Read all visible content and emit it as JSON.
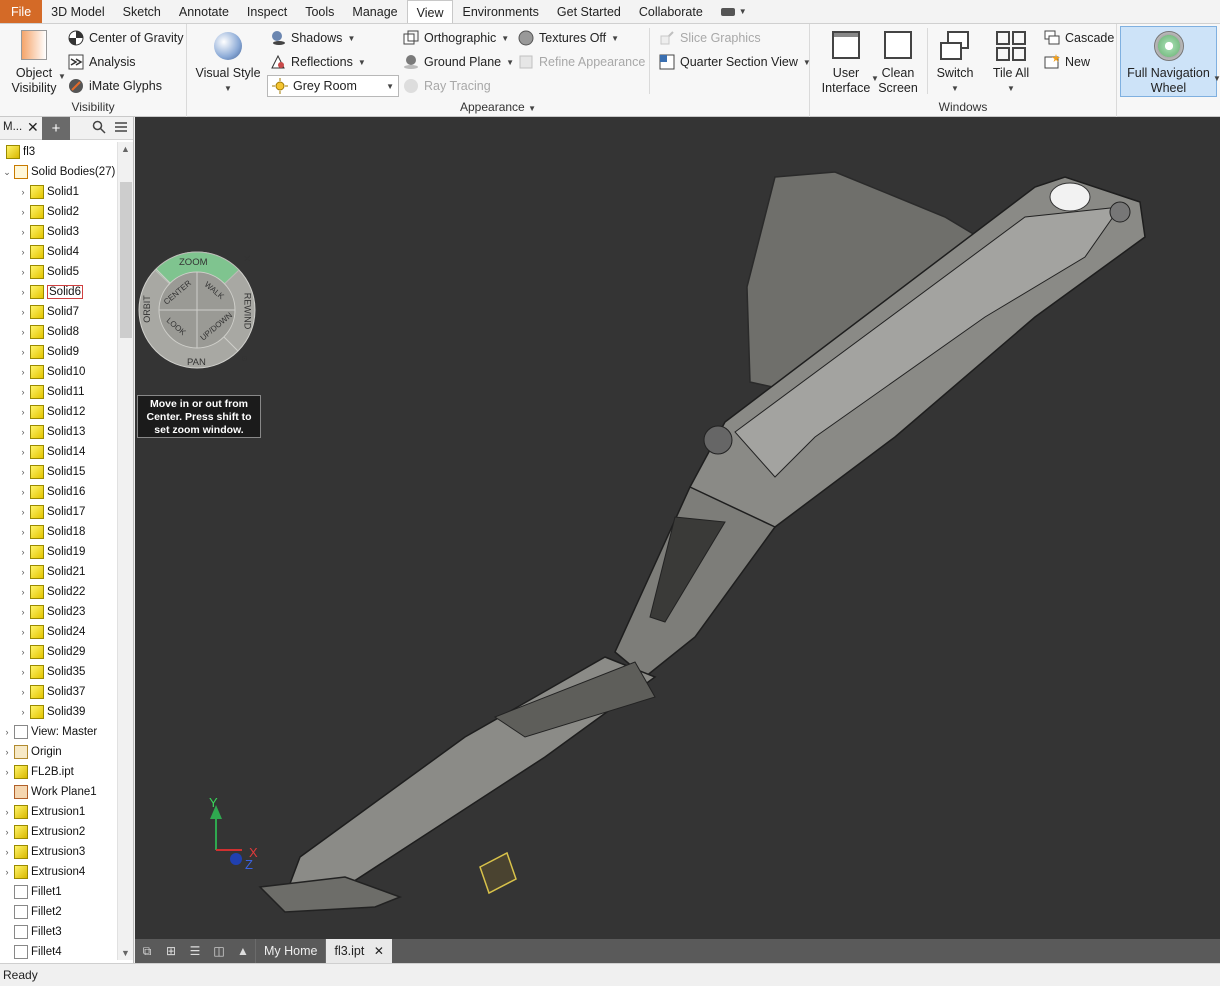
{
  "menu": {
    "tabs": [
      "File",
      "3D Model",
      "Sketch",
      "Annotate",
      "Inspect",
      "Tools",
      "Manage",
      "View",
      "Environments",
      "Get Started",
      "Collaborate"
    ],
    "active_tab": "View"
  },
  "ribbon": {
    "visibility": {
      "title": "Visibility",
      "object_visibility": "Object\nVisibility",
      "center_of_gravity": "Center of Gravity",
      "analysis": "Analysis",
      "imate_glyphs": "iMate Glyphs"
    },
    "appearance": {
      "title": "Appearance",
      "visual_style": "Visual Style",
      "shadows": "Shadows",
      "reflections": "Reflections",
      "lighting_value": "Grey Room",
      "orthographic": "Orthographic",
      "ground_plane": "Ground Plane",
      "ray_tracing": "Ray Tracing",
      "textures_off": "Textures Off",
      "refine_appearance": "Refine Appearance",
      "slice_graphics": "Slice Graphics",
      "quarter_section_view": "Quarter Section View"
    },
    "windows": {
      "title": "Windows",
      "user_interface": "User\nInterface",
      "clean_screen": "Clean\nScreen",
      "switch": "Switch",
      "tile_all": "Tile All",
      "cascade": "Cascade",
      "new": "New"
    },
    "navigate": {
      "full_navigation_wheel": "Full Navigation\nWheel"
    }
  },
  "browser": {
    "header_label": "M...",
    "root": "fl3",
    "solid_bodies": "Solid Bodies(27)",
    "solids": [
      "Solid1",
      "Solid2",
      "Solid3",
      "Solid4",
      "Solid5",
      "Solid6",
      "Solid7",
      "Solid8",
      "Solid9",
      "Solid10",
      "Solid11",
      "Solid12",
      "Solid13",
      "Solid14",
      "Solid15",
      "Solid16",
      "Solid17",
      "Solid18",
      "Solid19",
      "Solid21",
      "Solid22",
      "Solid23",
      "Solid24",
      "Solid29",
      "Solid35",
      "Solid37",
      "Solid39"
    ],
    "selected_solid": "Solid6",
    "features": [
      "View: Master",
      "Origin",
      "FL2B.ipt",
      "Work Plane1",
      "Extrusion1",
      "Extrusion2",
      "Extrusion3",
      "Extrusion4",
      "Fillet1",
      "Fillet2",
      "Fillet3",
      "Fillet4"
    ]
  },
  "viewport": {
    "navwheel": {
      "zoom": "ZOOM",
      "orbit": "ORBIT",
      "center": "CENTER",
      "walk": "WALK",
      "rewind": "REWIND",
      "look": "LOOK",
      "updown": "UP/DOWN",
      "pan": "PAN"
    },
    "tooltip": "Move in or out from Center. Press shift to set zoom window.",
    "axis": {
      "x": "X",
      "y": "Y",
      "z": "Z"
    }
  },
  "doctabs": {
    "home": "My Home",
    "file": "fl3.ipt"
  },
  "status": "Ready",
  "colors": {
    "file_tab": "#d46a27",
    "viewport_bg": "#343434",
    "navwheel_zoom": "#7fc48f"
  }
}
